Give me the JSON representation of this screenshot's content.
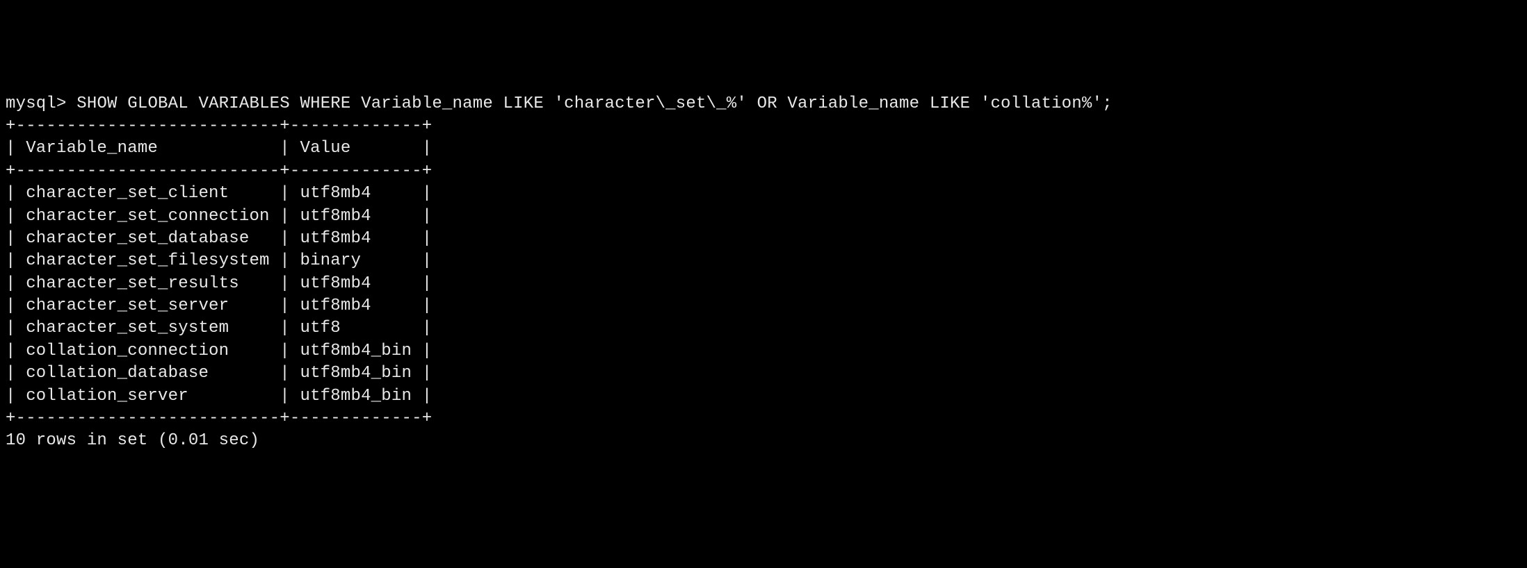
{
  "prompt": "mysql>",
  "command": "SHOW GLOBAL VARIABLES WHERE Variable_name LIKE 'character\\_set\\_%' OR Variable_name LIKE 'collation%';",
  "table": {
    "separator_top": "+--------------------------+-------------+",
    "header_row": "| Variable_name            | Value       |",
    "separator_mid": "+--------------------------+-------------+",
    "columns": [
      "Variable_name",
      "Value"
    ],
    "rows": [
      {
        "name": "character_set_client",
        "value": "utf8mb4"
      },
      {
        "name": "character_set_connection",
        "value": "utf8mb4"
      },
      {
        "name": "character_set_database",
        "value": "utf8mb4"
      },
      {
        "name": "character_set_filesystem",
        "value": "binary"
      },
      {
        "name": "character_set_results",
        "value": "utf8mb4"
      },
      {
        "name": "character_set_server",
        "value": "utf8mb4"
      },
      {
        "name": "character_set_system",
        "value": "utf8"
      },
      {
        "name": "collation_connection",
        "value": "utf8mb4_bin"
      },
      {
        "name": "collation_database",
        "value": "utf8mb4_bin"
      },
      {
        "name": "collation_server",
        "value": "utf8mb4_bin"
      }
    ],
    "separator_bottom": "+--------------------------+-------------+",
    "col1_width": 24,
    "col2_width": 11
  },
  "footer": "10 rows in set (0.01 sec)"
}
